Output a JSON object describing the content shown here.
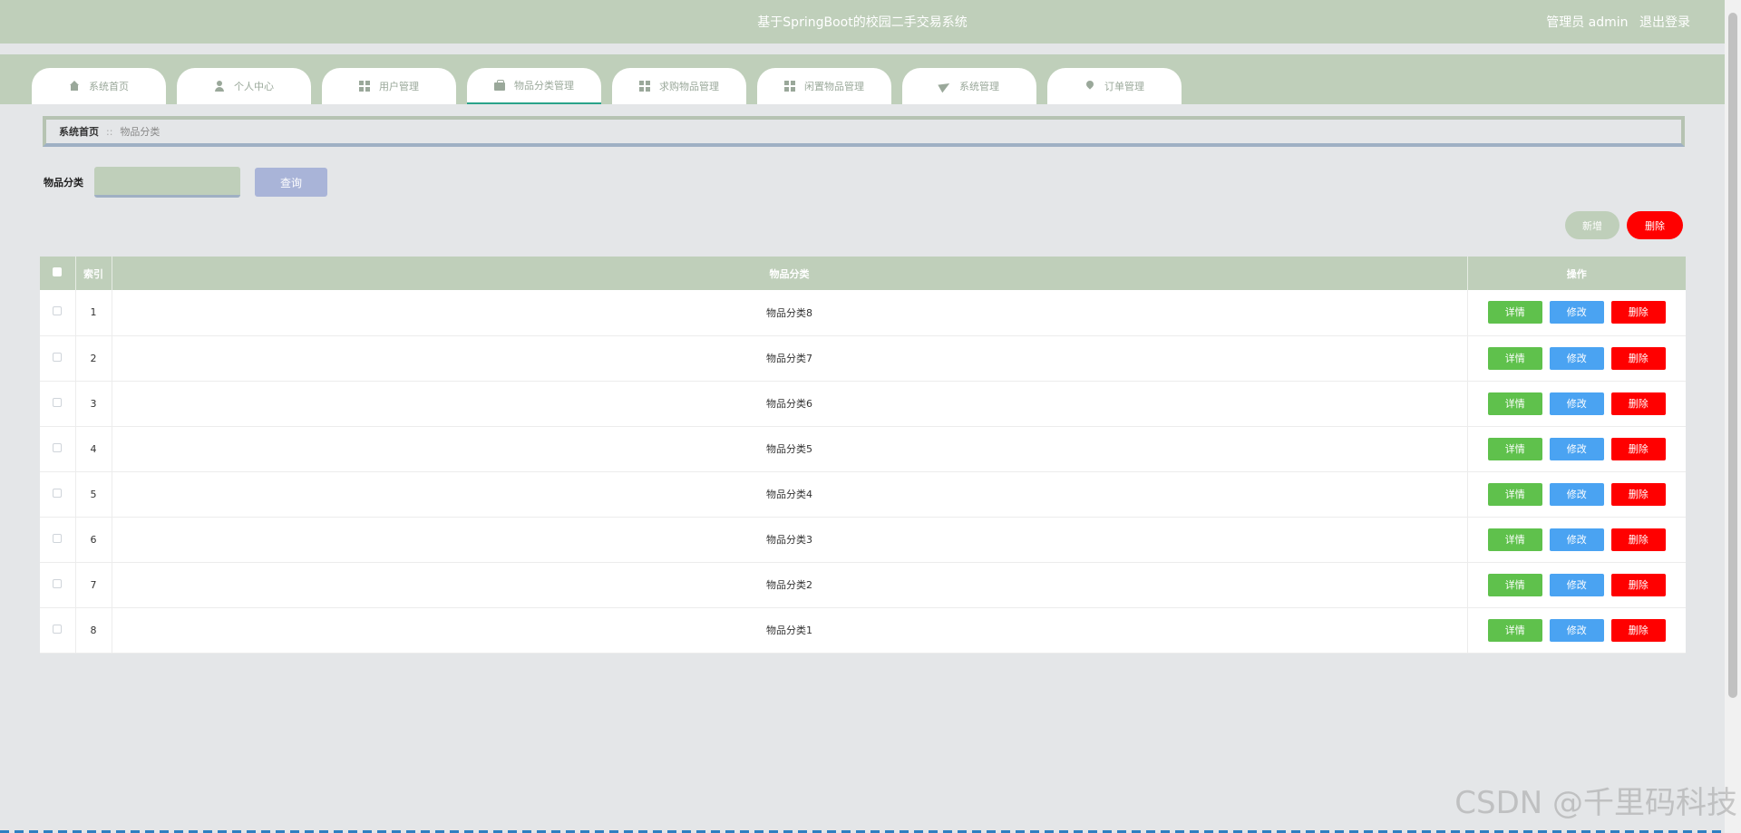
{
  "header": {
    "title": "基于SpringBoot的校园二手交易系统",
    "user_label": "管理员 admin",
    "logout_label": "退出登录"
  },
  "nav": {
    "tabs": [
      {
        "label": "系统首页",
        "icon": "home-icon"
      },
      {
        "label": "个人中心",
        "icon": "user-icon"
      },
      {
        "label": "用户管理",
        "icon": "grid-icon"
      },
      {
        "label": "物品分类管理",
        "icon": "bag-icon"
      },
      {
        "label": "求购物品管理",
        "icon": "grid-icon"
      },
      {
        "label": "闲置物品管理",
        "icon": "grid-icon"
      },
      {
        "label": "系统管理",
        "icon": "plane-icon"
      },
      {
        "label": "订单管理",
        "icon": "pin-icon"
      }
    ],
    "active_index": 3
  },
  "breadcrumb": {
    "home": "系统首页",
    "separator": "::",
    "current": "物品分类"
  },
  "search": {
    "label": "物品分类",
    "value": "",
    "button": "查询"
  },
  "actions": {
    "add": "新增",
    "delete": "删除"
  },
  "table": {
    "headers": {
      "index": "索引",
      "category": "物品分类",
      "ops": "操作"
    },
    "row_buttons": {
      "detail": "详情",
      "edit": "修改",
      "delete": "删除"
    },
    "rows": [
      {
        "index": "1",
        "category": "物品分类8"
      },
      {
        "index": "2",
        "category": "物品分类7"
      },
      {
        "index": "3",
        "category": "物品分类6"
      },
      {
        "index": "4",
        "category": "物品分类5"
      },
      {
        "index": "5",
        "category": "物品分类4"
      },
      {
        "index": "6",
        "category": "物品分类3"
      },
      {
        "index": "7",
        "category": "物品分类2"
      },
      {
        "index": "8",
        "category": "物品分类1"
      }
    ]
  },
  "watermark": "CSDN @千里码科技",
  "colors": {
    "header_bg": "#bfcfba",
    "page_bg": "#e4e6e8",
    "detail_btn": "#5fc14c",
    "edit_btn": "#4aa3f2",
    "delete_btn": "#ff0000",
    "search_btn": "#a9b4d8"
  }
}
